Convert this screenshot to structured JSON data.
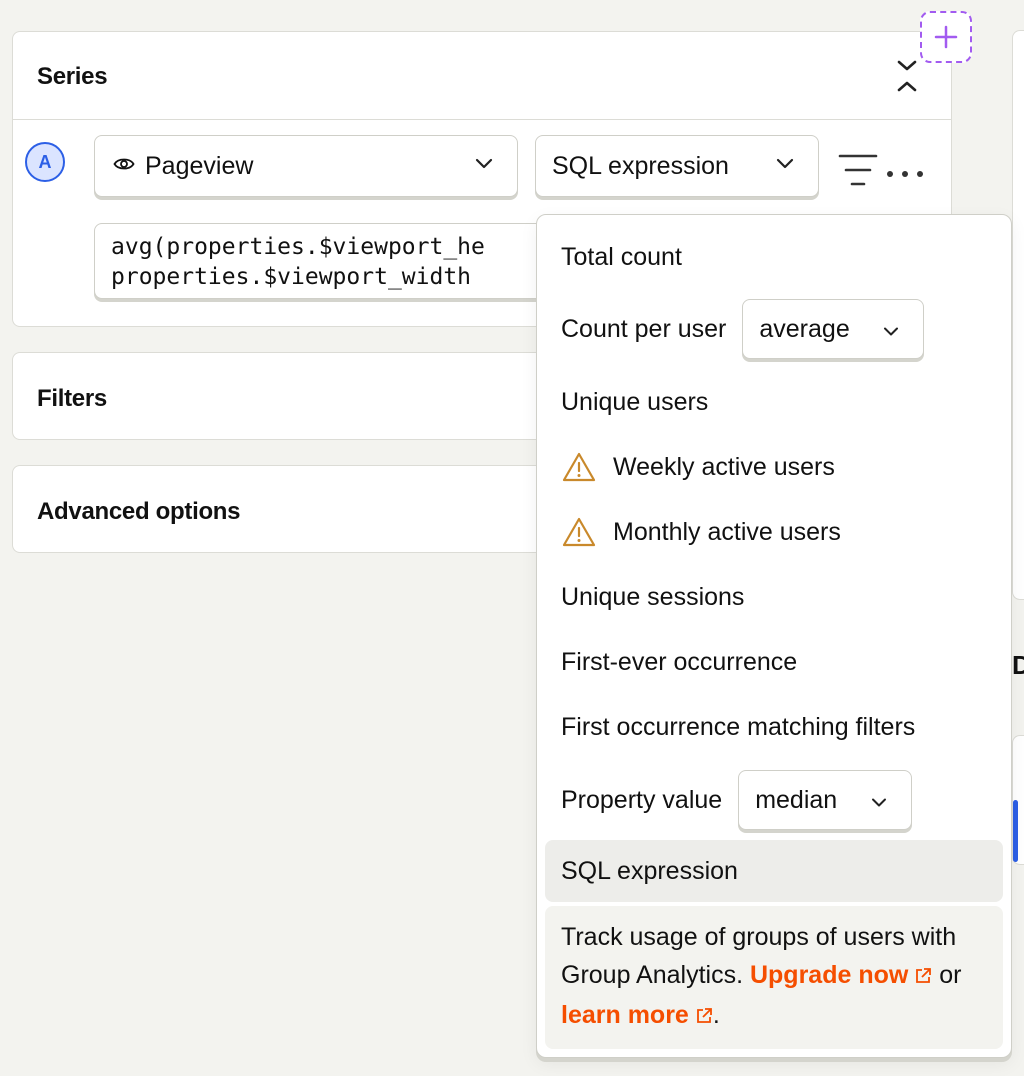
{
  "series": {
    "title": "Series",
    "letter": "A",
    "event": "Pageview",
    "math": "SQL expression",
    "expression_line1": "avg(properties.$viewport_he",
    "expression_line2": "properties.$viewport_width"
  },
  "filters": {
    "title": "Filters"
  },
  "advanced": {
    "title": "Advanced options"
  },
  "edge": {
    "letter": "D"
  },
  "colors": {
    "accent": "#2c5fe6",
    "link": "#f54e00",
    "add": "#a25bf0",
    "warning": "#c9892b"
  },
  "menu": {
    "total_count": "Total count",
    "count_per_user": "Count per user",
    "count_per_user_agg": "average",
    "unique_users": "Unique users",
    "weekly_active": "Weekly active users",
    "monthly_active": "Monthly active users",
    "unique_sessions": "Unique sessions",
    "first_ever": "First-ever occurrence",
    "first_matching": "First occurrence matching filters",
    "property_value": "Property value",
    "property_value_agg": "median",
    "sql_expression": "SQL expression"
  },
  "upgrade": {
    "text1": "Track usage of groups of users with Group Analytics.",
    "upgrade_link": "Upgrade now",
    "or": "or",
    "learn_link": "learn more",
    "end": "."
  }
}
